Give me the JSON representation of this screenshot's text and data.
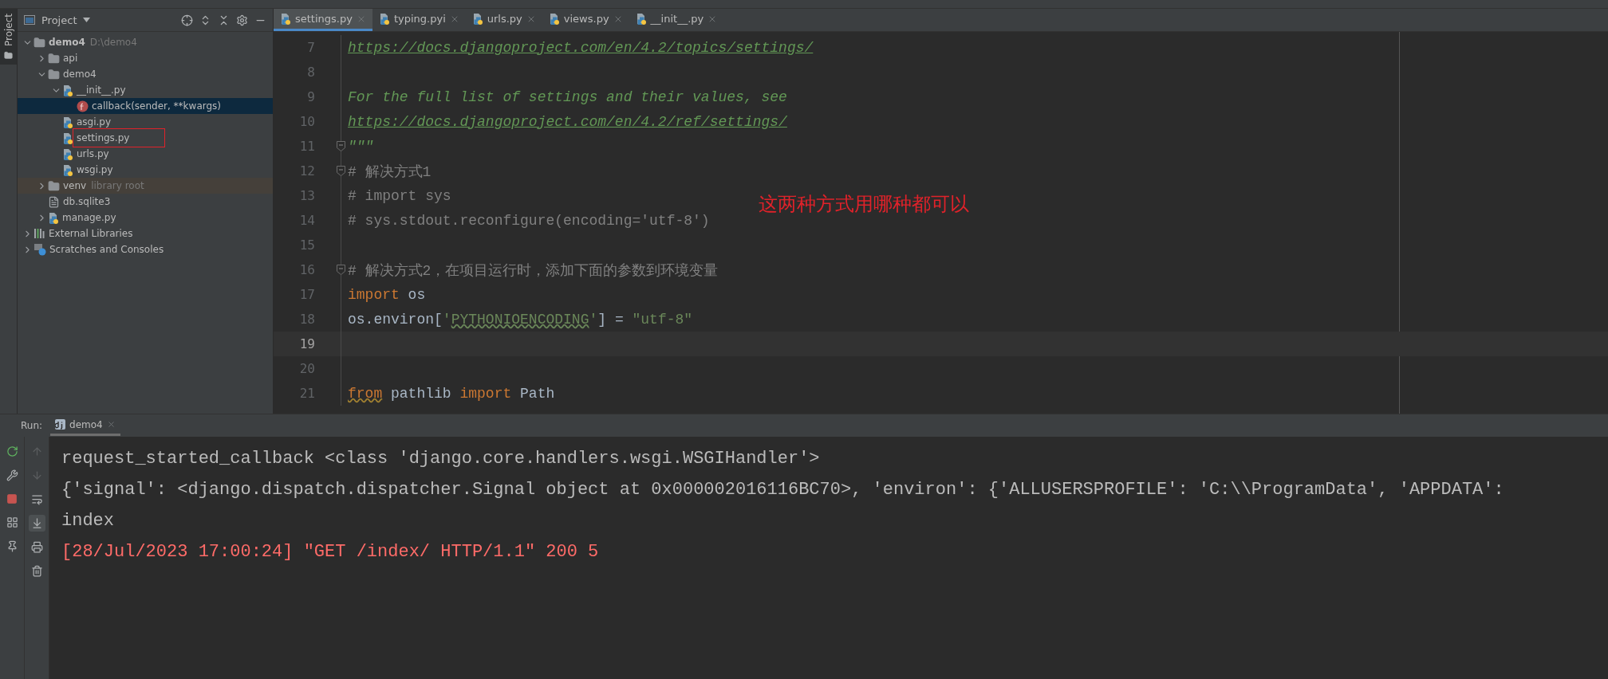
{
  "project_panel": {
    "title": "Project",
    "vertical_tab": "Project",
    "tree": [
      {
        "name": "demo4",
        "hint": "D:\\demo4",
        "kind": "root",
        "expanded": true,
        "selected": false,
        "boxed": false,
        "children": [
          {
            "name": "api",
            "kind": "package",
            "expanded": false,
            "selected": false,
            "boxed": false
          },
          {
            "name": "demo4",
            "kind": "package",
            "expanded": true,
            "selected": false,
            "boxed": false,
            "children": [
              {
                "name": "__init__.py",
                "kind": "python",
                "expanded": true,
                "selected": false,
                "boxed": false,
                "children": [
                  {
                    "name": "callback(sender, **kwargs)",
                    "kind": "function",
                    "selected": true,
                    "boxed": false
                  }
                ]
              },
              {
                "name": "asgi.py",
                "kind": "python",
                "selected": false,
                "boxed": false
              },
              {
                "name": "settings.py",
                "kind": "python",
                "selected": false,
                "boxed": true
              },
              {
                "name": "urls.py",
                "kind": "python",
                "selected": false,
                "boxed": false
              },
              {
                "name": "wsgi.py",
                "kind": "python",
                "selected": false,
                "boxed": false
              }
            ]
          },
          {
            "name": "venv",
            "hint": "library root",
            "kind": "library",
            "expanded": false,
            "selected": false,
            "boxed": false
          },
          {
            "name": "db.sqlite3",
            "kind": "file",
            "selected": false,
            "boxed": false
          },
          {
            "name": "manage.py",
            "kind": "python",
            "expanded": false,
            "selected": false,
            "boxed": false
          }
        ]
      },
      {
        "name": "External Libraries",
        "kind": "libraries",
        "expanded": false,
        "selected": false,
        "boxed": false
      },
      {
        "name": "Scratches and Consoles",
        "kind": "scratches",
        "expanded": false,
        "selected": false,
        "boxed": false
      }
    ]
  },
  "editor": {
    "tabs": [
      {
        "label": "settings.py",
        "selected": true
      },
      {
        "label": "typing.pyi",
        "selected": false
      },
      {
        "label": "urls.py",
        "selected": false
      },
      {
        "label": "views.py",
        "selected": false
      },
      {
        "label": "__init__.py",
        "selected": false
      }
    ],
    "lines": [
      {
        "number": "7",
        "current": false,
        "fold": false,
        "tokens": [
          {
            "kind": "link",
            "text": "https://docs.djangoproject.com/en/4.2/topics/settings/"
          }
        ]
      },
      {
        "number": "8",
        "current": false,
        "fold": false
      },
      {
        "number": "9",
        "current": false,
        "fold": false,
        "tokens": [
          {
            "kind": "doc",
            "text": "For the full list of settings and their values, see"
          }
        ]
      },
      {
        "number": "10",
        "current": false,
        "fold": false,
        "tokens": [
          {
            "kind": "link",
            "text": "https://docs.djangoproject.com/en/4.2/ref/settings/"
          }
        ]
      },
      {
        "number": "11",
        "current": false,
        "fold": true,
        "tokens": [
          {
            "kind": "doc",
            "text": "\"\"\""
          }
        ]
      },
      {
        "number": "12",
        "current": false,
        "fold": true,
        "tokens": [
          {
            "kind": "comment",
            "text": "# 解决方式1"
          }
        ]
      },
      {
        "number": "13",
        "current": false,
        "fold": false,
        "tokens": [
          {
            "kind": "comment",
            "text": "# import sys"
          }
        ]
      },
      {
        "number": "14",
        "current": false,
        "fold": false,
        "tokens": [
          {
            "kind": "comment",
            "text": "# sys.stdout.reconfigure(encoding='utf-8')"
          }
        ]
      },
      {
        "number": "15",
        "current": false,
        "fold": false
      },
      {
        "number": "16",
        "current": false,
        "fold": true,
        "tokens": [
          {
            "kind": "comment",
            "text": "# 解决方式2，在项目运行时，添加下面的参数到环境变量"
          }
        ]
      },
      {
        "number": "17",
        "current": false,
        "fold": false,
        "tokens": [
          {
            "kind": "keyword",
            "text": "import"
          },
          {
            "kind": "plain",
            "text": " os"
          }
        ]
      },
      {
        "number": "18",
        "current": false,
        "fold": false,
        "tokens": [
          {
            "kind": "plain",
            "text": "os.environ["
          },
          {
            "kind": "string",
            "text": "'"
          },
          {
            "kind": "string-typo",
            "text": "PYTHONIOENCODING"
          },
          {
            "kind": "string",
            "text": "'"
          },
          {
            "kind": "plain",
            "text": "] = "
          },
          {
            "kind": "string",
            "text": "\"utf-8\""
          }
        ]
      },
      {
        "number": "19",
        "current": true,
        "fold": false
      },
      {
        "number": "20",
        "current": false,
        "fold": false
      },
      {
        "number": "21",
        "current": false,
        "fold": false,
        "tokens": [
          {
            "kind": "keyword-typo",
            "text": "from"
          },
          {
            "kind": "plain",
            "text": " pathlib "
          },
          {
            "kind": "keyword",
            "text": "import"
          },
          {
            "kind": "plain",
            "text": " Path"
          }
        ]
      }
    ],
    "annotation": "这两种方式用哪种都可以"
  },
  "run_panel": {
    "label": "Run:",
    "tab": "demo4",
    "console": [
      {
        "kind": "normal",
        "text": "request_started_callback <class 'django.core.handlers.wsgi.WSGIHandler'>"
      },
      {
        "kind": "normal",
        "text": "{'signal': <django.dispatch.dispatcher.Signal object at 0x000002016116BC70>, 'environ': {'ALLUSERSPROFILE': 'C:\\\\ProgramData', 'APPDATA':"
      },
      {
        "kind": "normal",
        "text": "index"
      },
      {
        "kind": "error",
        "text": "[28/Jul/2023 17:00:24] \"GET /index/ HTTP/1.1\" 200 5"
      }
    ]
  }
}
